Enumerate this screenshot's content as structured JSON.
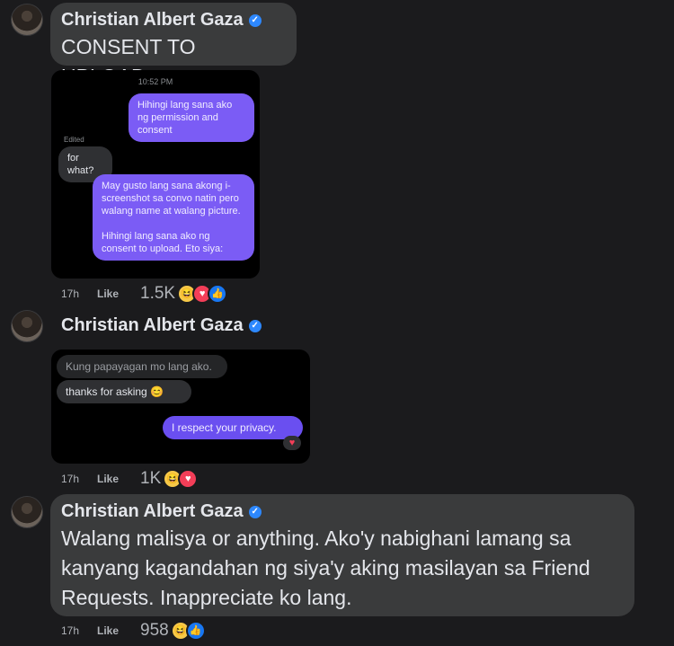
{
  "author": {
    "name": "Christian Albert Gaza",
    "verified_icon": "verified-badge-icon"
  },
  "comments": [
    {
      "text": "CONSENT TO UPLOAD",
      "time": "17h",
      "like_label": "Like",
      "reaction_count": "1.5K",
      "reactions": [
        "haha",
        "heart",
        "like"
      ],
      "screenshot": {
        "timestamp": "10:52 PM",
        "edited_label": "Edited",
        "messages": [
          {
            "side": "sent",
            "text": "Hihingi lang sana ako ng permission and consent"
          },
          {
            "side": "recv",
            "text": "for what?"
          },
          {
            "side": "sent",
            "text": "May gusto lang sana akong i-screenshot sa convo natin pero walang name at walang picture.\n\nHihingi lang sana ako ng consent to upload. Eto siya:"
          }
        ]
      }
    },
    {
      "text": "",
      "time": "17h",
      "like_label": "Like",
      "reaction_count": "1K",
      "reactions": [
        "haha",
        "heart"
      ],
      "screenshot": {
        "messages": [
          {
            "side": "recv",
            "text": "Kung papayagan mo lang ako."
          },
          {
            "side": "recv",
            "text": "thanks for asking 😊"
          },
          {
            "side": "sent",
            "text": "I respect your privacy."
          }
        ],
        "reaction_icon": "heart"
      }
    },
    {
      "text": "Walang malisya or anything. Ako'y nabighani lamang sa kanyang kagandahan ng siya'y aking masilayan sa Friend Requests. Inappreciate ko lang.",
      "time": "17h",
      "like_label": "Like",
      "reaction_count": "958",
      "reactions": [
        "haha",
        "like"
      ]
    }
  ],
  "colors": {
    "background": "#1b1b1d",
    "bubble": "#3a3b3c",
    "sent": "#7b5cf5",
    "verified": "#2d88ff"
  }
}
